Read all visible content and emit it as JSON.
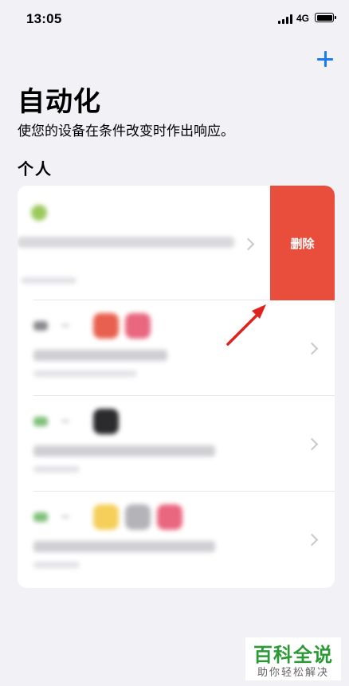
{
  "status_bar": {
    "time": "13:05",
    "network": "4G"
  },
  "header": {
    "title": "自动化",
    "subtitle": "使您的设备在条件改变时作出响应。"
  },
  "section": {
    "title": "个人"
  },
  "swipe_action": {
    "label": "删除",
    "color": "#e94e3d"
  },
  "accent_color": "#1a7cf5",
  "watermark": {
    "title": "百科全说",
    "subtitle": "助你轻松解决"
  }
}
